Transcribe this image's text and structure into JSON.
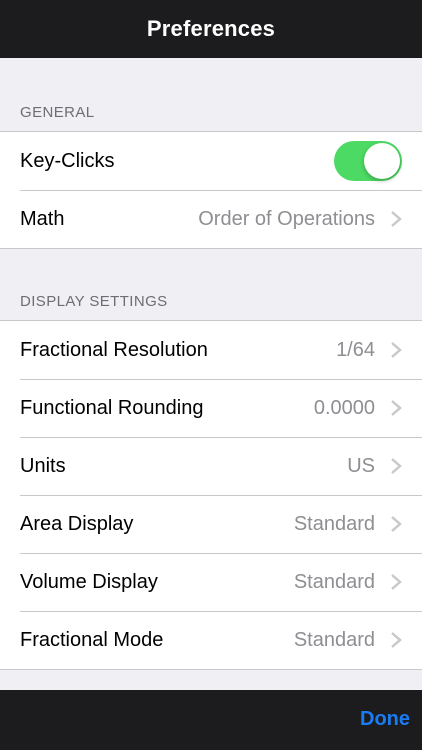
{
  "navbar": {
    "title": "Preferences"
  },
  "general": {
    "header": "GENERAL",
    "key_clicks": {
      "label": "Key-Clicks",
      "on": true
    },
    "math": {
      "label": "Math",
      "value": "Order of Operations"
    }
  },
  "display": {
    "header": "DISPLAY SETTINGS",
    "rows": [
      {
        "label": "Fractional Resolution",
        "value": "1/64"
      },
      {
        "label": "Functional Rounding",
        "value": "0.0000"
      },
      {
        "label": "Units",
        "value": "US"
      },
      {
        "label": "Area Display",
        "value": "Standard"
      },
      {
        "label": "Volume Display",
        "value": "Standard"
      },
      {
        "label": "Fractional Mode",
        "value": "Standard"
      }
    ]
  },
  "toolbar": {
    "done_label": "Done"
  },
  "colors": {
    "accent": "#1a7bf2",
    "toggle_on": "#4cd964",
    "bar_bg": "#1c1c1e"
  },
  "icons": {
    "chevron": "chevron-right-icon"
  }
}
